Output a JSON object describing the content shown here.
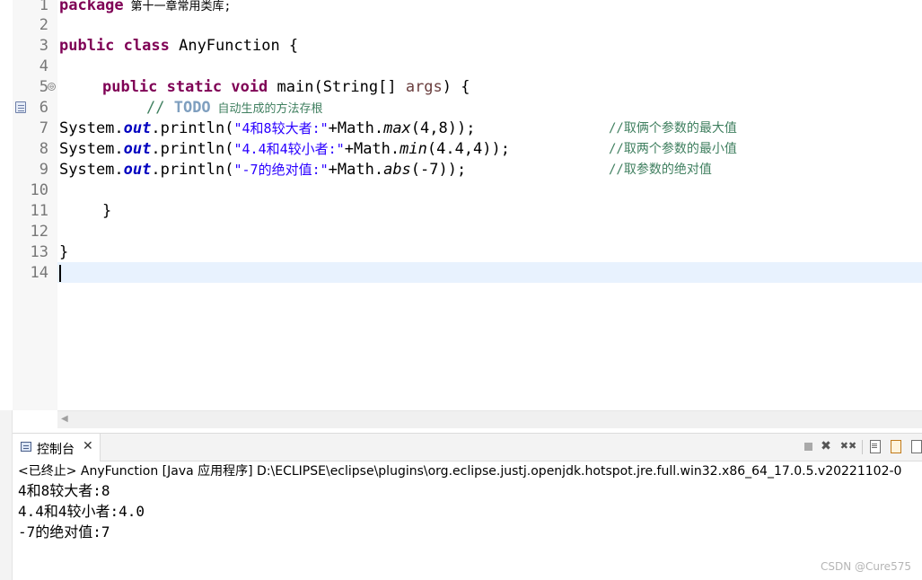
{
  "editor": {
    "line_numbers": [
      "1",
      "2",
      "3",
      "4",
      "5",
      "6",
      "7",
      "8",
      "9",
      "10",
      "11",
      "12",
      "13",
      "14"
    ],
    "fold_marker": "⊖",
    "lines": {
      "l1_kw": "package",
      "l1_rest": " 第十一章常用类库;",
      "l3_kw1": "public",
      "l3_kw2": "class",
      "l3_rest": " AnyFunction {",
      "l5_kw1": "public",
      "l5_kw2": "static",
      "l5_kw3": "void",
      "l5_pre": " main(String[] ",
      "l5_arg": "args",
      "l5_post": ") {",
      "l6_comment": "// ",
      "l6_todo": "TODO",
      "l6_text": " 自动生成的方法存根",
      "l7_a": "System.",
      "l7_out": "out",
      "l7_b": ".println(",
      "l7_str": "\"4和8较大者:\"",
      "l7_c": "+Math.",
      "l7_m": "max",
      "l7_d": "(4,8));",
      "l7_cm": "//取俩个参数的最大值",
      "l8_a": "System.",
      "l8_out": "out",
      "l8_b": ".println(",
      "l8_str": "\"4.4和4较小者:\"",
      "l8_c": "+Math.",
      "l8_m": "min",
      "l8_d": "(4.4,4));",
      "l8_cm": "//取两个参数的最小值",
      "l9_a": "System.",
      "l9_out": "out",
      "l9_b": ".println(",
      "l9_str": "\"-7的绝对值:\"",
      "l9_c": "+Math.",
      "l9_m": "abs",
      "l9_d": "(-7));",
      "l9_cm": "//取参数的绝对值",
      "l11": "}",
      "l13": "}"
    },
    "scroll_left_arrow": "◀"
  },
  "console": {
    "tab_label": "控制台",
    "tab_close": "✕",
    "remove_label": "✖",
    "remove_all_label": "✖✖",
    "header": "<已终止> AnyFunction [Java 应用程序] D:\\ECLIPSE\\eclipse\\plugins\\org.eclipse.justj.openjdk.hotspot.jre.full.win32.x86_64_17.0.5.v20221102-0",
    "output": [
      "4和8较大者:8",
      "4.4和4较小者:4.0",
      "-7的绝对值:7"
    ]
  },
  "watermark": "CSDN @Cure575",
  "colors": {
    "keyword": "#7f0055",
    "string": "#2a00ff",
    "field": "#0000c0",
    "comment": "#3f7f5f",
    "todo": "#7f9fbf",
    "current_line": "#e8f2fe"
  }
}
